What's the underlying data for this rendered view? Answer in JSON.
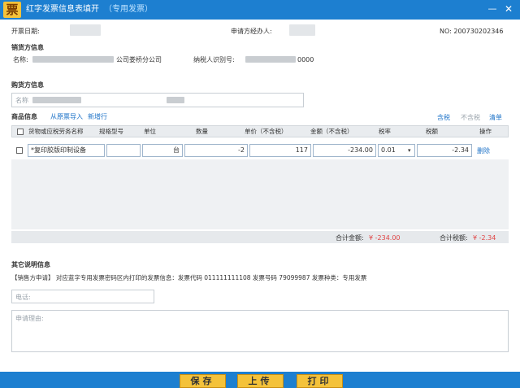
{
  "window": {
    "app_icon": "票",
    "title": "红字发票信息表填开",
    "subtitle": "（专用发票）",
    "minimize_icon": "minimize-icon",
    "close_icon": "close-icon"
  },
  "header": {
    "issue_date_label": "开票日期:",
    "applicant_label": "申请方经办人:",
    "number": "NO: 200730202346"
  },
  "seller": {
    "section_title": "销货方信息",
    "name_label": "名称:",
    "name_value": "公司娄桥分公司",
    "taxid_label": "纳税人识别号:",
    "taxid_value": "0000"
  },
  "buyer": {
    "section_title": "购货方信息",
    "name_placeholder": "名称"
  },
  "goods": {
    "section_title": "商品信息",
    "links": [
      "从原票导入",
      "新增行"
    ],
    "actions": {
      "tax_included": "含税",
      "tax_excluded": "不含税",
      "clear": "清单"
    },
    "columns": [
      "货物或应税劳务名称",
      "规格型号",
      "单位",
      "数量",
      "单价（不含税）",
      "金额（不含税）",
      "税率",
      "税额",
      "操作"
    ],
    "rows": [
      {
        "name": "*复印胶版印制设备",
        "spec": "",
        "unit": "台",
        "quantity": "-2",
        "price": "117",
        "amount": "-234.00",
        "rate": "0.01",
        "tax": "-2.34",
        "action": "删除"
      }
    ],
    "total_amount_label": "合计金额:",
    "total_amount": "¥ -234.00",
    "total_tax_label": "合计税额:",
    "total_tax": "¥ -2.34"
  },
  "other": {
    "section_title": "其它说明信息",
    "description": "【销售方申请】 对应蓝字专用发票密码区内打印的发票信息：发票代码 011111111108 发票号码 79099987 发票种类：专用发票",
    "phone_placeholder": "电话:",
    "reason_placeholder": "申请理由:"
  },
  "buttons": {
    "save": "保存",
    "upload": "上传",
    "print": "打印"
  },
  "colors": {
    "title_bar": "#1d7fd0",
    "button": "#f4c23a",
    "link": "#1e73c8",
    "negative": "#e04545"
  }
}
